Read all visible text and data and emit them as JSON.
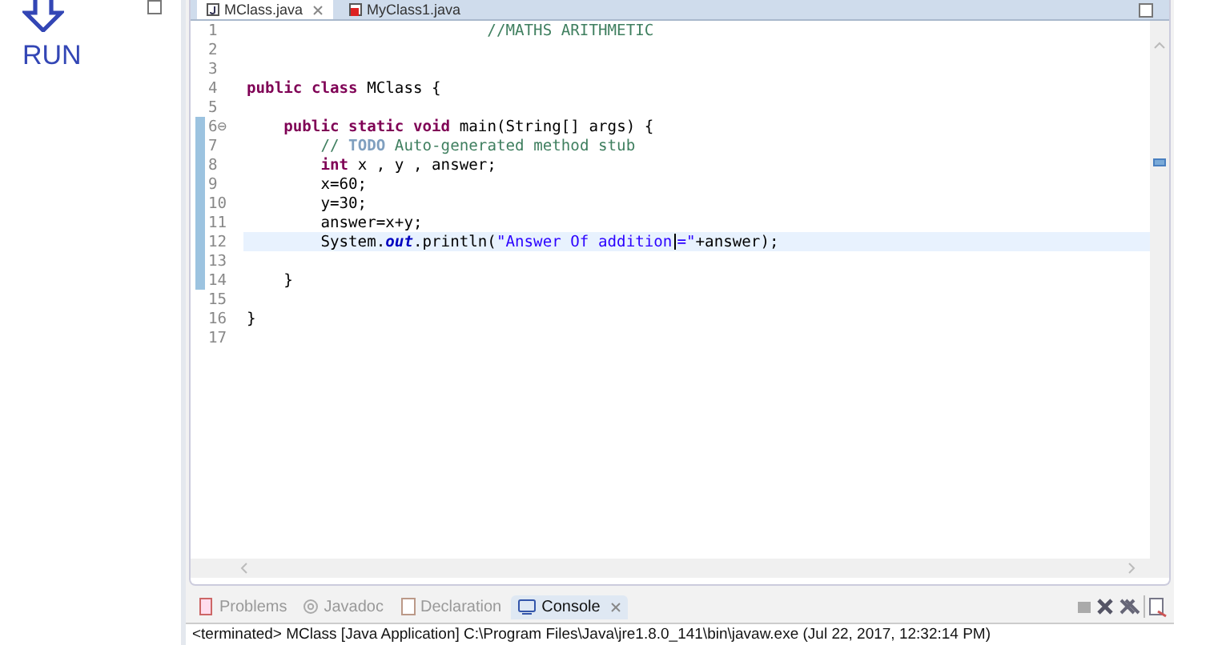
{
  "annotation": {
    "label": "RUN"
  },
  "editor_tabs": [
    {
      "label": "MClass.java",
      "selected": true,
      "kind": "java"
    },
    {
      "label": "MyClass1.java",
      "selected": false,
      "kind": "java-error"
    }
  ],
  "code_lines": [
    {
      "number": "1",
      "changed": false,
      "current": false,
      "tokens": [
        {
          "kind": "comment",
          "text": "                          //MATHS ARITHMETIC"
        }
      ]
    },
    {
      "number": "2",
      "changed": false,
      "current": false
    },
    {
      "number": "3",
      "changed": false,
      "current": false
    },
    {
      "number": "4",
      "changed": false,
      "current": false,
      "tokens": [
        {
          "kind": "keyword",
          "text": "public "
        },
        {
          "kind": "keyword",
          "text": "class "
        },
        {
          "kind": "plain",
          "text": "MClass {"
        }
      ]
    },
    {
      "number": "5",
      "changed": false,
      "current": false
    },
    {
      "number": "6⊖",
      "changed": true,
      "current": false,
      "tokens": [
        {
          "kind": "keyword",
          "text": "    public "
        },
        {
          "kind": "keyword",
          "text": "static "
        },
        {
          "kind": "keyword",
          "text": "void "
        },
        {
          "kind": "plain",
          "text": "main(String[] args) {"
        }
      ]
    },
    {
      "number": "7",
      "changed": true,
      "current": false,
      "tokens": [
        {
          "kind": "comment",
          "text": "        // "
        },
        {
          "kind": "todo",
          "text": "TODO"
        },
        {
          "kind": "comment",
          "text": " Auto-generated method stub"
        }
      ]
    },
    {
      "number": "8",
      "changed": true,
      "current": false,
      "tokens": [
        {
          "kind": "keyword",
          "text": "        int "
        },
        {
          "kind": "plain",
          "text": "x , y , answer;"
        }
      ]
    },
    {
      "number": "9",
      "changed": true,
      "current": false,
      "tokens": [
        {
          "kind": "plain",
          "text": "        x=60;"
        }
      ]
    },
    {
      "number": "10",
      "changed": true,
      "current": false,
      "tokens": [
        {
          "kind": "plain",
          "text": "        y=30;"
        }
      ]
    },
    {
      "number": "11",
      "changed": true,
      "current": false,
      "tokens": [
        {
          "kind": "plain",
          "text": "        answer=x+y;"
        }
      ]
    },
    {
      "number": "12",
      "changed": true,
      "current": true,
      "tokens": [
        {
          "kind": "plain",
          "text": "        System."
        },
        {
          "kind": "static-field",
          "text": "out"
        },
        {
          "kind": "plain",
          "text": ".println("
        },
        {
          "kind": "string",
          "text": "\"Answer Of addition",
          "caret_after": true
        },
        {
          "kind": "string",
          "text": "=\""
        },
        {
          "kind": "plain",
          "text": "+answer);"
        }
      ]
    },
    {
      "number": "13",
      "changed": true,
      "current": false
    },
    {
      "number": "14",
      "changed": true,
      "current": false,
      "tokens": [
        {
          "kind": "plain",
          "text": "    }"
        }
      ]
    },
    {
      "number": "15",
      "changed": false,
      "current": false
    },
    {
      "number": "16",
      "changed": false,
      "current": false,
      "tokens": [
        {
          "kind": "plain",
          "text": "}"
        }
      ]
    },
    {
      "number": "17",
      "changed": false,
      "current": false
    }
  ],
  "bottom_tabs": [
    {
      "label": "Problems",
      "selected": false,
      "kind": "problems"
    },
    {
      "label": "Javadoc",
      "selected": false,
      "kind": "javadoc"
    },
    {
      "label": "Declaration",
      "selected": false,
      "kind": "declaration"
    },
    {
      "label": "Console",
      "selected": true,
      "kind": "console"
    }
  ],
  "console": {
    "status": "<terminated> MClass [Java Application] C:\\Program Files\\Java\\jre1.8.0_141\\bin\\javaw.exe (Jul 22, 2017, 12:32:14 PM)"
  }
}
